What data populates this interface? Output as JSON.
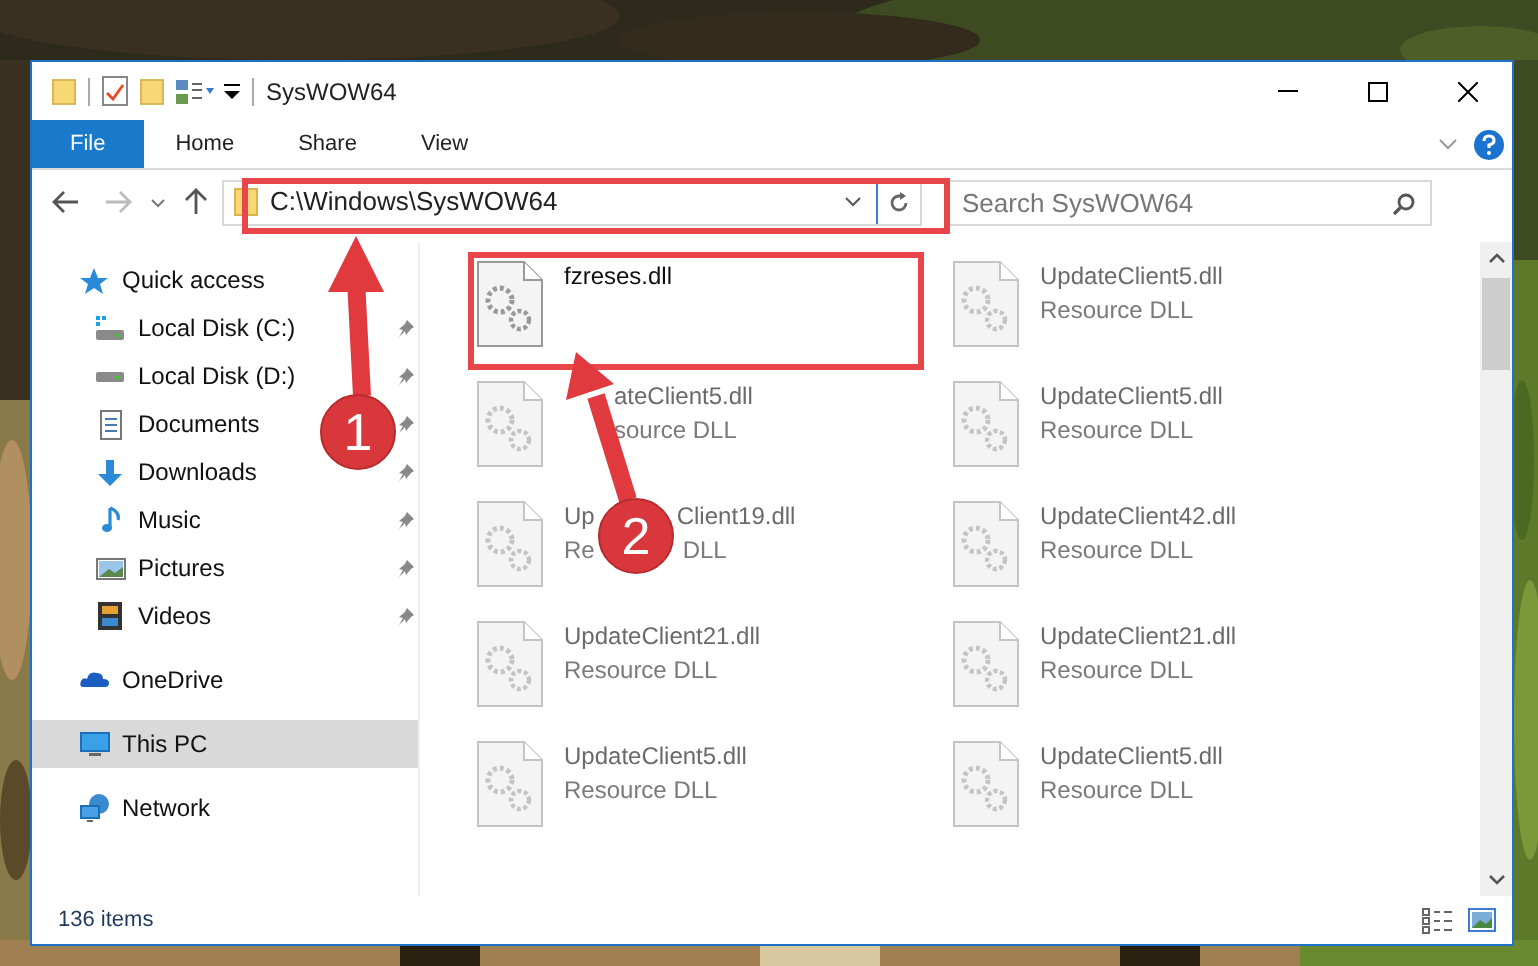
{
  "window": {
    "title": "SysWOW64"
  },
  "ribbon_tabs": [
    {
      "label": "File",
      "selected": true
    },
    {
      "label": "Home",
      "selected": false
    },
    {
      "label": "Share",
      "selected": false
    },
    {
      "label": "View",
      "selected": false
    }
  ],
  "address": {
    "path": "C:\\Windows\\SysWOW64"
  },
  "search": {
    "placeholder": "Search SysWOW64"
  },
  "nav": [
    {
      "kind": "section",
      "label": "Quick access",
      "pinned": false,
      "selected": false
    },
    {
      "kind": "item",
      "label": "Local Disk (C:)",
      "pinned": true,
      "selected": false
    },
    {
      "kind": "item",
      "label": "Local Disk (D:)",
      "pinned": true,
      "selected": false
    },
    {
      "kind": "item",
      "label": "Documents",
      "pinned": true,
      "selected": false
    },
    {
      "kind": "item",
      "label": "Downloads",
      "pinned": true,
      "selected": false
    },
    {
      "kind": "item",
      "label": "Music",
      "pinned": true,
      "selected": false
    },
    {
      "kind": "item",
      "label": "Pictures",
      "pinned": true,
      "selected": false
    },
    {
      "kind": "item",
      "label": "Videos",
      "pinned": true,
      "selected": false
    },
    {
      "kind": "section",
      "label": "OneDrive",
      "pinned": false,
      "selected": false
    },
    {
      "kind": "section",
      "label": "This PC",
      "pinned": false,
      "selected": true
    },
    {
      "kind": "section",
      "label": "Network",
      "pinned": false,
      "selected": false
    }
  ],
  "files": [
    {
      "name": [
        "fzreses.dll"
      ],
      "blurred": false
    },
    {
      "name": [
        "UpdateClient5.dll"
      ],
      "type": [
        "Resource DLL"
      ],
      "blurred": true
    },
    {
      "name": [
        "ateClient5.dll"
      ],
      "type": [
        "source DLL"
      ],
      "blurred": true
    },
    {
      "name": [
        "UpdateClient5.dll"
      ],
      "type": [
        "Resource DLL"
      ],
      "blurred": true
    },
    {
      "name": [
        "Up",
        "Client19.dll"
      ],
      "type": [
        "Re",
        "DLL"
      ],
      "blurred": true
    },
    {
      "name": [
        "UpdateClient42.dll"
      ],
      "type": [
        "Resource DLL"
      ],
      "blurred": true
    },
    {
      "name": [
        "UpdateClient21.dll"
      ],
      "type": [
        "Resource DLL"
      ],
      "blurred": true
    },
    {
      "name": [
        "UpdateClient21.dll"
      ],
      "type": [
        "Resource DLL"
      ],
      "blurred": true
    },
    {
      "name": [
        "UpdateClient5.dll"
      ],
      "type": [
        "Resource DLL"
      ],
      "blurred": true
    },
    {
      "name": [
        "UpdateClient5.dll"
      ],
      "type": [
        "Resource DLL"
      ],
      "blurred": true
    }
  ],
  "status_bar": {
    "count": "136 items"
  },
  "annotations": [
    {
      "number": "1"
    },
    {
      "number": "2"
    }
  ]
}
